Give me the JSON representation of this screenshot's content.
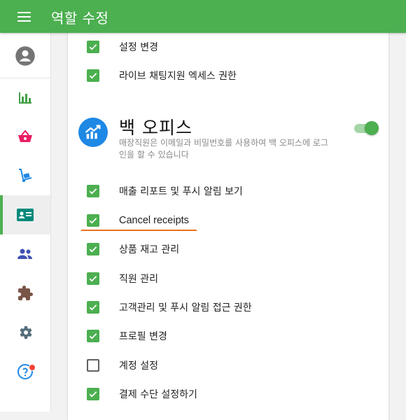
{
  "header": {
    "title": "역할 수정",
    "menu_icon": "menu-icon"
  },
  "sidebar": {
    "items": [
      {
        "icon": "account-circle-icon",
        "color": "#757575"
      },
      {
        "icon": "bar-chart-icon",
        "color": "#43a047"
      },
      {
        "icon": "basket-icon",
        "color": "#e91e63"
      },
      {
        "icon": "hand-truck-icon",
        "color": "#1e88e5"
      },
      {
        "icon": "contact-card-icon",
        "color": "#00897b",
        "active": true
      },
      {
        "icon": "people-icon",
        "color": "#3f51b5"
      },
      {
        "icon": "puzzle-icon",
        "color": "#795548"
      },
      {
        "icon": "gear-icon",
        "color": "#546e7a"
      },
      {
        "icon": "help-icon",
        "color": "#1e88e5",
        "notification": true
      }
    ]
  },
  "permissions_top": [
    {
      "label": "설정 변경",
      "checked": true
    },
    {
      "label": "라이브 채팅지원 엑세스 권한",
      "checked": true
    }
  ],
  "back_office": {
    "title": "백 오피스",
    "description": "매장직원은 이메일과 비밀번호를 사용하여 백 오피스에 로그인을 할 수 있습니다",
    "enabled": true,
    "icon_color": "#1e88e5"
  },
  "permissions": [
    {
      "label": "매출 리포트 및 푸시 알림 보기",
      "checked": true
    },
    {
      "label": "Cancel receipts",
      "checked": true,
      "highlighted": true
    },
    {
      "label": "상품 재고 관리",
      "checked": true
    },
    {
      "label": "직원 관리",
      "checked": true
    },
    {
      "label": "고객관리 및 푸시 알림 접근 권한",
      "checked": true
    },
    {
      "label": "프로필 변경",
      "checked": true
    },
    {
      "label": "계정 설정",
      "checked": false
    },
    {
      "label": "결제 수단 설정하기",
      "checked": true
    }
  ],
  "colors": {
    "accent": "#4caf50",
    "highlight": "#e8721c"
  }
}
